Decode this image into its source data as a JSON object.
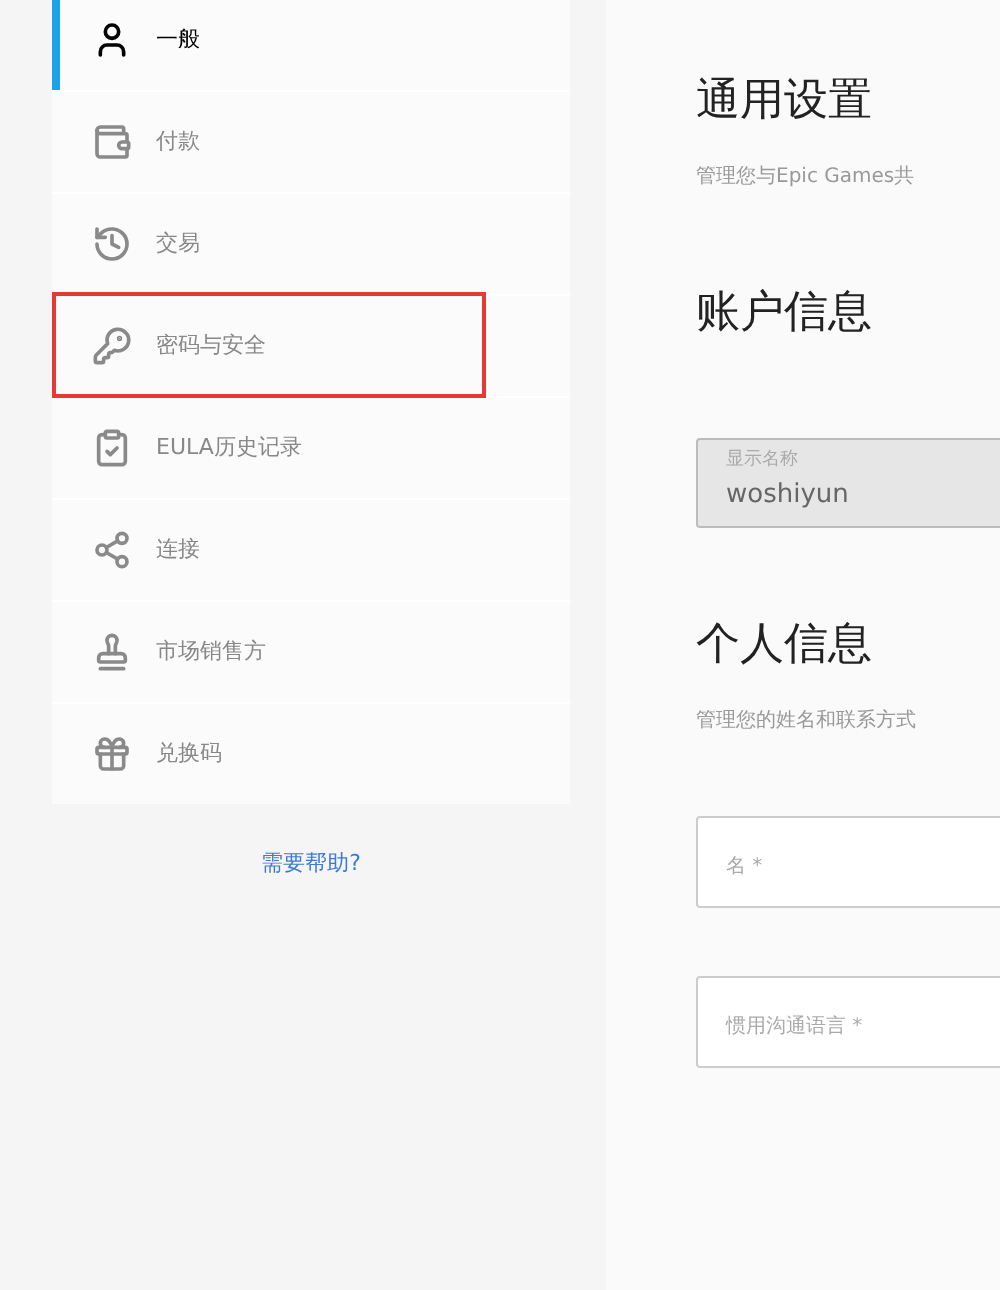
{
  "sidebar": {
    "items": [
      {
        "kind": "user",
        "label": "一般",
        "selected": true,
        "highlighted": false
      },
      {
        "kind": "wallet",
        "label": "付款",
        "selected": false,
        "highlighted": false
      },
      {
        "kind": "history",
        "label": "交易",
        "selected": false,
        "highlighted": false
      },
      {
        "kind": "key",
        "label": "密码与安全",
        "selected": false,
        "highlighted": true
      },
      {
        "kind": "clipboard",
        "label": "EULA历史记录",
        "selected": false,
        "highlighted": false
      },
      {
        "kind": "share",
        "label": "连接",
        "selected": false,
        "highlighted": false
      },
      {
        "kind": "stamp",
        "label": "市场销售方",
        "selected": false,
        "highlighted": false
      },
      {
        "kind": "gift",
        "label": "兑换码",
        "selected": false,
        "highlighted": false
      }
    ],
    "help_link": "需要帮助?"
  },
  "main": {
    "title": "通用设置",
    "subtitle": "管理您与Epic Games共",
    "account": {
      "heading": "账户信息",
      "field": {
        "label": "显示名称",
        "value": "woshiyun",
        "disabled": true
      }
    },
    "personal": {
      "heading": "个人信息",
      "description": "管理您的姓名和联系方式",
      "fields": [
        {
          "label": "名 *"
        },
        {
          "label": "惯用沟通语言 *"
        }
      ]
    }
  }
}
